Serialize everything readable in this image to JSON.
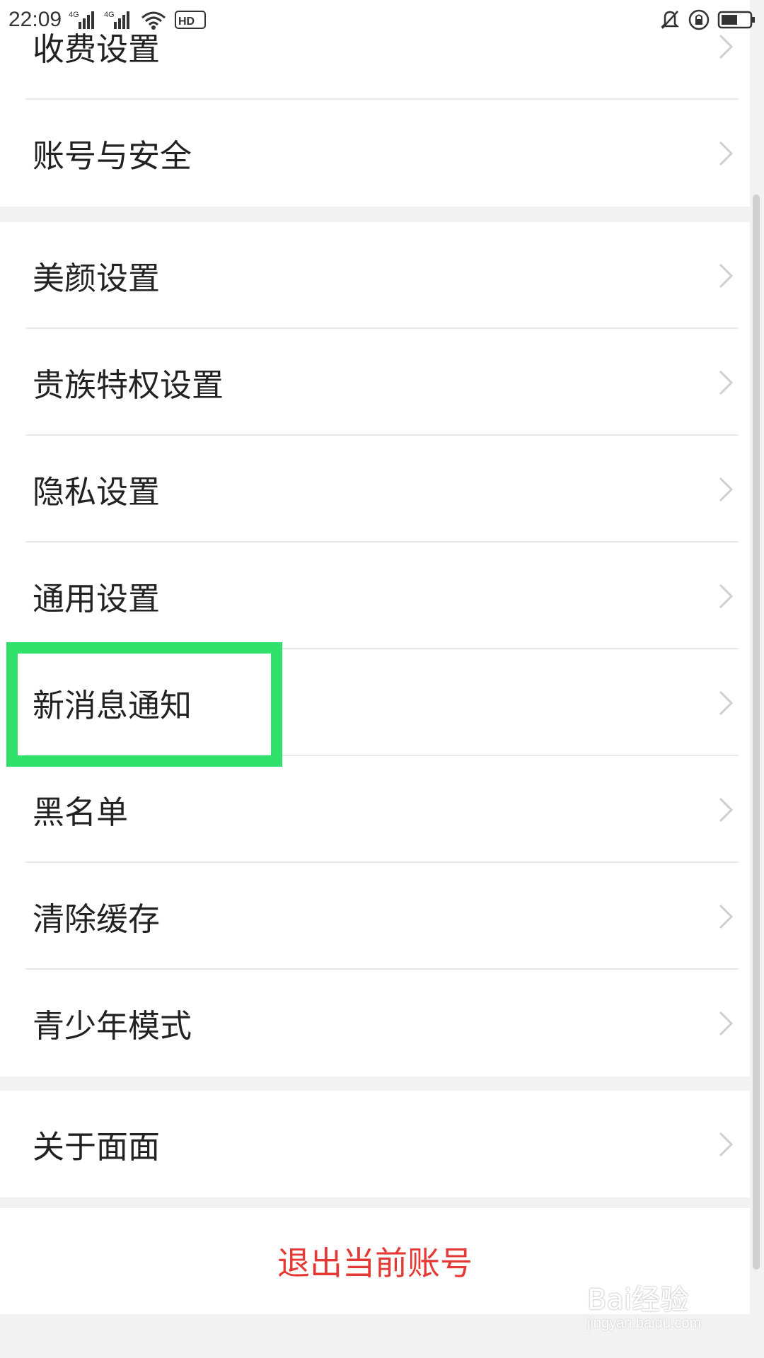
{
  "status_bar": {
    "time": "22:09",
    "net1": "4G",
    "net2": "4G",
    "hd": "HD",
    "icons": [
      "signal-icon",
      "signal-icon",
      "wifi-icon",
      "hd-icon",
      "mute-bell-icon",
      "rotation-lock-icon",
      "battery-icon"
    ]
  },
  "groups": [
    {
      "items": [
        {
          "label": "收费设置"
        },
        {
          "label": "账号与安全"
        }
      ]
    },
    {
      "items": [
        {
          "label": "美颜设置"
        },
        {
          "label": "贵族特权设置"
        },
        {
          "label": "隐私设置"
        },
        {
          "label": "通用设置"
        },
        {
          "label": "新消息通知"
        },
        {
          "label": "黑名单"
        },
        {
          "label": "清除缓存"
        },
        {
          "label": "青少年模式"
        }
      ]
    },
    {
      "items": [
        {
          "label": "关于面面"
        }
      ]
    }
  ],
  "logout": {
    "label": "退出当前账号",
    "color": "#e53935"
  },
  "highlight": {
    "target": "新消息通知",
    "color": "#2fe06a"
  },
  "watermark": {
    "brand": "Bai经验",
    "url": "jingyan.baidu.com"
  }
}
